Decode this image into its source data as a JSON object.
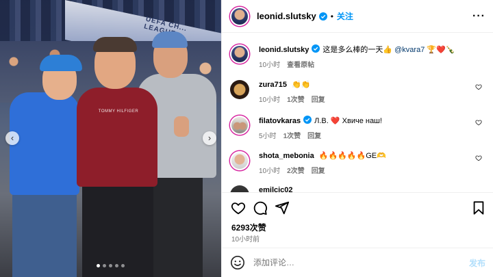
{
  "photo": {
    "banner_text": "UEFA CH... LEAGUE",
    "shirt_text": "TOMMY HILFIGER",
    "carousel": {
      "prev_icon": "chevron-left-icon",
      "next_icon": "chevron-right-icon",
      "dots": 5,
      "active_index": 0
    }
  },
  "header": {
    "username": "leonid.slutsky",
    "separator": "•",
    "follow_label": "关注",
    "more_label": "···"
  },
  "caption": {
    "username": "leonid.slutsky",
    "text": "这是多么棒的一天👍",
    "mention": "@kvara7",
    "emojis": "🏆❤️🍾",
    "time": "10小时",
    "translate_label": "查看原帖"
  },
  "comments": [
    {
      "username": "zura715",
      "text": "👏👏",
      "time": "10小时",
      "likes": "1次赞",
      "reply_label": "回复"
    },
    {
      "username": "filatovkaras",
      "verified": true,
      "text": "Л.В. ❤️ Хвиче наш!",
      "time": "5小时",
      "likes": "1次赞",
      "reply_label": "回复"
    },
    {
      "username": "shota_mebonia",
      "text": "🔥🔥🔥🔥🔥GE🫶",
      "time": "10小时",
      "likes": "2次赞",
      "reply_label": "回复"
    },
    {
      "username": "emilcic02"
    }
  ],
  "stats": {
    "likes": "6293次赞",
    "posted": "10小时前"
  },
  "compose": {
    "placeholder": "添加评论…",
    "post_label": "发布"
  },
  "colors": {
    "accent": "#0095f6",
    "verified": "#0095f6",
    "muted": "#737373",
    "border": "#efefef"
  }
}
